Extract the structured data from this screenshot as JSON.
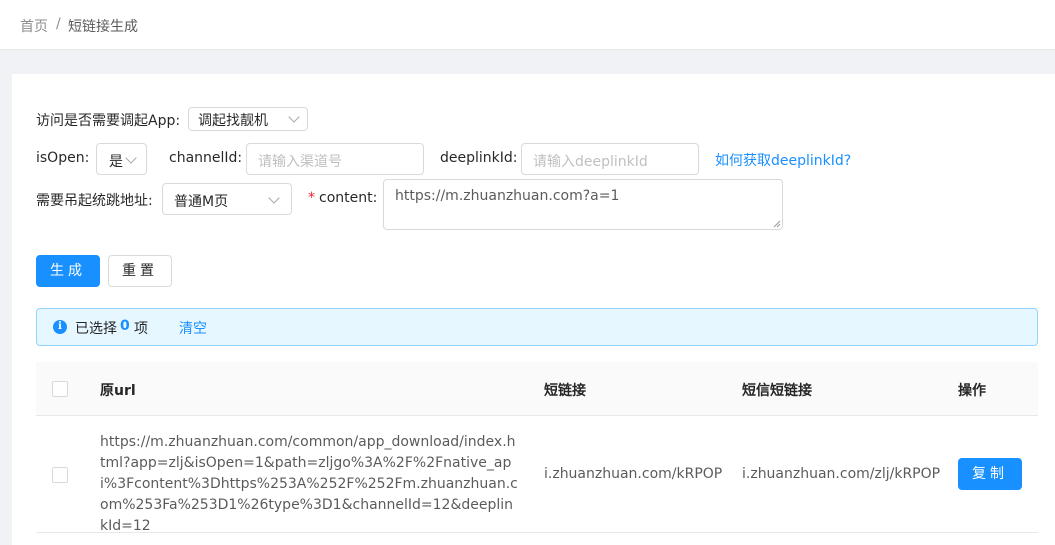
{
  "breadcrumb": {
    "home": "首页",
    "separator": "/",
    "current": "短链接生成"
  },
  "form": {
    "invoke_app": {
      "label": "访问是否需要调起App",
      "colon": ":",
      "value": "调起找靓机"
    },
    "is_open": {
      "label": "isOpen",
      "colon": ":",
      "value": "是"
    },
    "channel_id": {
      "label": "channelId",
      "colon": ":",
      "placeholder": "请输入渠道号"
    },
    "deeplink_id": {
      "label": "deeplinkId",
      "colon": ":",
      "placeholder": "请输入deeplinkId"
    },
    "deeplink_help": "如何获取deeplinkId?",
    "jump_address": {
      "label": "需要吊起统跳地址",
      "colon": ":",
      "value": "普通M页"
    },
    "content": {
      "required_mark": "*",
      "label": "content",
      "colon": ":",
      "value": "https://m.zhuanzhuan.com?a=1"
    }
  },
  "actions": {
    "generate": "生成",
    "reset": "重置"
  },
  "alert": {
    "prefix": "已选择",
    "count": "0",
    "suffix": "项",
    "clear": "清空"
  },
  "table": {
    "columns": [
      "原url",
      "短链接",
      "短信短链接",
      "操作"
    ],
    "rows": [
      {
        "original_url": "https://m.zhuanzhuan.com/common/app_download/index.html?app=zlj&isOpen=1&path=zljgo%3A%2F%2Fnative_api%3Fcontent%3Dhttps%253A%252F%252Fm.zhuanzhuan.com%253Fa%253D1%26type%3D1&channelId=12&deeplinkId=12",
        "short_link": "i.zhuanzhuan.com/kRPOP",
        "sms_short_link": "i.zhuanzhuan.com/zlj/kRPOP",
        "action": "复制"
      }
    ]
  },
  "colors": {
    "primary": "#1890ff",
    "alert_bg": "#e6f7ff",
    "alert_border": "#91d5ff",
    "required": "#f5222d"
  },
  "icons": [
    "info-icon",
    "chevron-down-icon",
    "textarea-resize-icon"
  ]
}
